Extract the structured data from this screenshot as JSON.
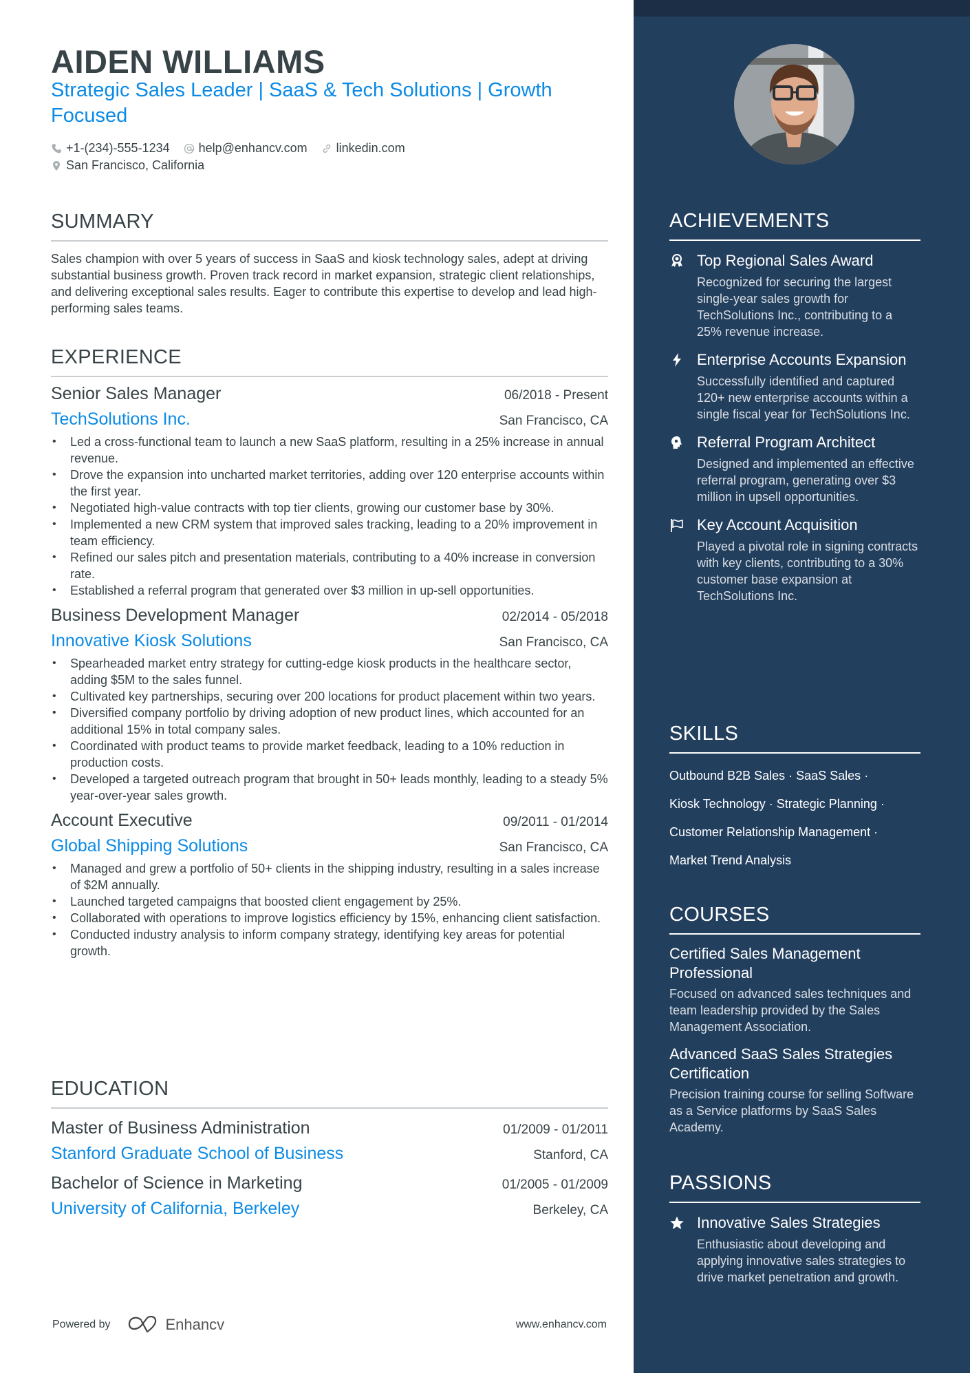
{
  "header": {
    "name": "AIDEN WILLIAMS",
    "headline": "Strategic Sales Leader | SaaS & Tech Solutions | Growth Focused",
    "phone": "+1-(234)-555-1234",
    "email": "help@enhancv.com",
    "linkedin": "linkedin.com",
    "location": "San Francisco, California"
  },
  "summary": {
    "title": "SUMMARY",
    "text": "Sales champion with over 5 years of success in SaaS and kiosk technology sales, adept at driving substantial business growth. Proven track record in market expansion, strategic client relationships, and delivering exceptional sales results. Eager to contribute this expertise to develop and lead high-performing sales teams."
  },
  "experience": {
    "title": "EXPERIENCE",
    "jobs": [
      {
        "title": "Senior Sales Manager",
        "dates": "06/2018 - Present",
        "company": "TechSolutions Inc.",
        "location": "San Francisco, CA",
        "bullets": [
          "Led a cross-functional team to launch a new SaaS platform, resulting in a 25% increase in annual revenue.",
          "Drove the expansion into uncharted market territories, adding over 120 enterprise accounts within the first year.",
          "Negotiated high-value contracts with top tier clients, growing our customer base by 30%.",
          "Implemented a new CRM system that improved sales tracking, leading to a 20% improvement in team efficiency.",
          "Refined our sales pitch and presentation materials, contributing to a 40% increase in conversion rate.",
          "Established a referral program that generated over $3 million in up-sell opportunities."
        ]
      },
      {
        "title": "Business Development Manager",
        "dates": "02/2014 - 05/2018",
        "company": "Innovative Kiosk Solutions",
        "location": "San Francisco, CA",
        "bullets": [
          "Spearheaded market entry strategy for cutting-edge kiosk products in the healthcare sector, adding $5M to the sales funnel.",
          "Cultivated key partnerships, securing over 200 locations for product placement within two years.",
          "Diversified company portfolio by driving adoption of new product lines, which accounted for an additional 15% in total company sales.",
          "Coordinated with product teams to provide market feedback, leading to a 10% reduction in production costs.",
          "Developed a targeted outreach program that brought in 50+ leads monthly, leading to a steady 5% year-over-year sales growth."
        ]
      },
      {
        "title": "Account Executive",
        "dates": "09/2011 - 01/2014",
        "company": "Global Shipping Solutions",
        "location": "San Francisco, CA",
        "bullets": [
          "Managed and grew a portfolio of 50+ clients in the shipping industry, resulting in a sales increase of $2M annually.",
          "Launched targeted campaigns that boosted client engagement by 25%.",
          "Collaborated with operations to improve logistics efficiency by 15%, enhancing client satisfaction.",
          "Conducted industry analysis to inform company strategy, identifying key areas for potential growth."
        ]
      }
    ]
  },
  "education": {
    "title": "EDUCATION",
    "items": [
      {
        "degree": "Master of Business Administration",
        "dates": "01/2009 - 01/2011",
        "school": "Stanford Graduate School of Business",
        "location": "Stanford, CA"
      },
      {
        "degree": "Bachelor of Science in Marketing",
        "dates": "01/2005 - 01/2009",
        "school": "University of California, Berkeley",
        "location": "Berkeley, CA"
      }
    ]
  },
  "footer": {
    "powered_by": "Powered by",
    "brand": "Enhancv",
    "website": "www.enhancv.com"
  },
  "sidebar": {
    "achievements": {
      "title": "ACHIEVEMENTS",
      "items": [
        {
          "icon": "award-icon",
          "title": "Top Regional Sales Award",
          "desc": "Recognized for securing the largest single-year sales growth for TechSolutions Inc., contributing to a 25% revenue increase."
        },
        {
          "icon": "lightning-icon",
          "title": "Enterprise Accounts Expansion",
          "desc": "Successfully identified and captured 120+ new enterprise accounts within a single fiscal year for TechSolutions Inc."
        },
        {
          "icon": "brain-icon",
          "title": "Referral Program Architect",
          "desc": "Designed and implemented an effective referral program, generating over $3 million in upsell opportunities."
        },
        {
          "icon": "flag-icon",
          "title": "Key Account Acquisition",
          "desc": "Played a pivotal role in signing contracts with key clients, contributing to a 30% customer base expansion at TechSolutions Inc."
        }
      ]
    },
    "skills": {
      "title": "SKILLS",
      "items": [
        "Outbound B2B Sales",
        "SaaS Sales",
        "Kiosk Technology",
        "Strategic Planning",
        "Customer Relationship Management",
        "Market Trend Analysis"
      ]
    },
    "courses": {
      "title": "COURSES",
      "items": [
        {
          "title": "Certified Sales Management Professional",
          "desc": "Focused on advanced sales techniques and team leadership provided by the Sales Management Association."
        },
        {
          "title": "Advanced SaaS Sales Strategies Certification",
          "desc": "Precision training course for selling Software as a Service platforms by SaaS Sales Academy."
        }
      ]
    },
    "passions": {
      "title": "PASSIONS",
      "items": [
        {
          "icon": "star-icon",
          "title": "Innovative Sales Strategies",
          "desc": "Enthusiastic about developing and applying innovative sales strategies to drive market penetration and growth."
        }
      ]
    }
  },
  "colors": {
    "accent": "#0b8ae6",
    "text": "#384347",
    "sidebar": "#233f5e",
    "sidebar_band": "#1c2e45"
  }
}
